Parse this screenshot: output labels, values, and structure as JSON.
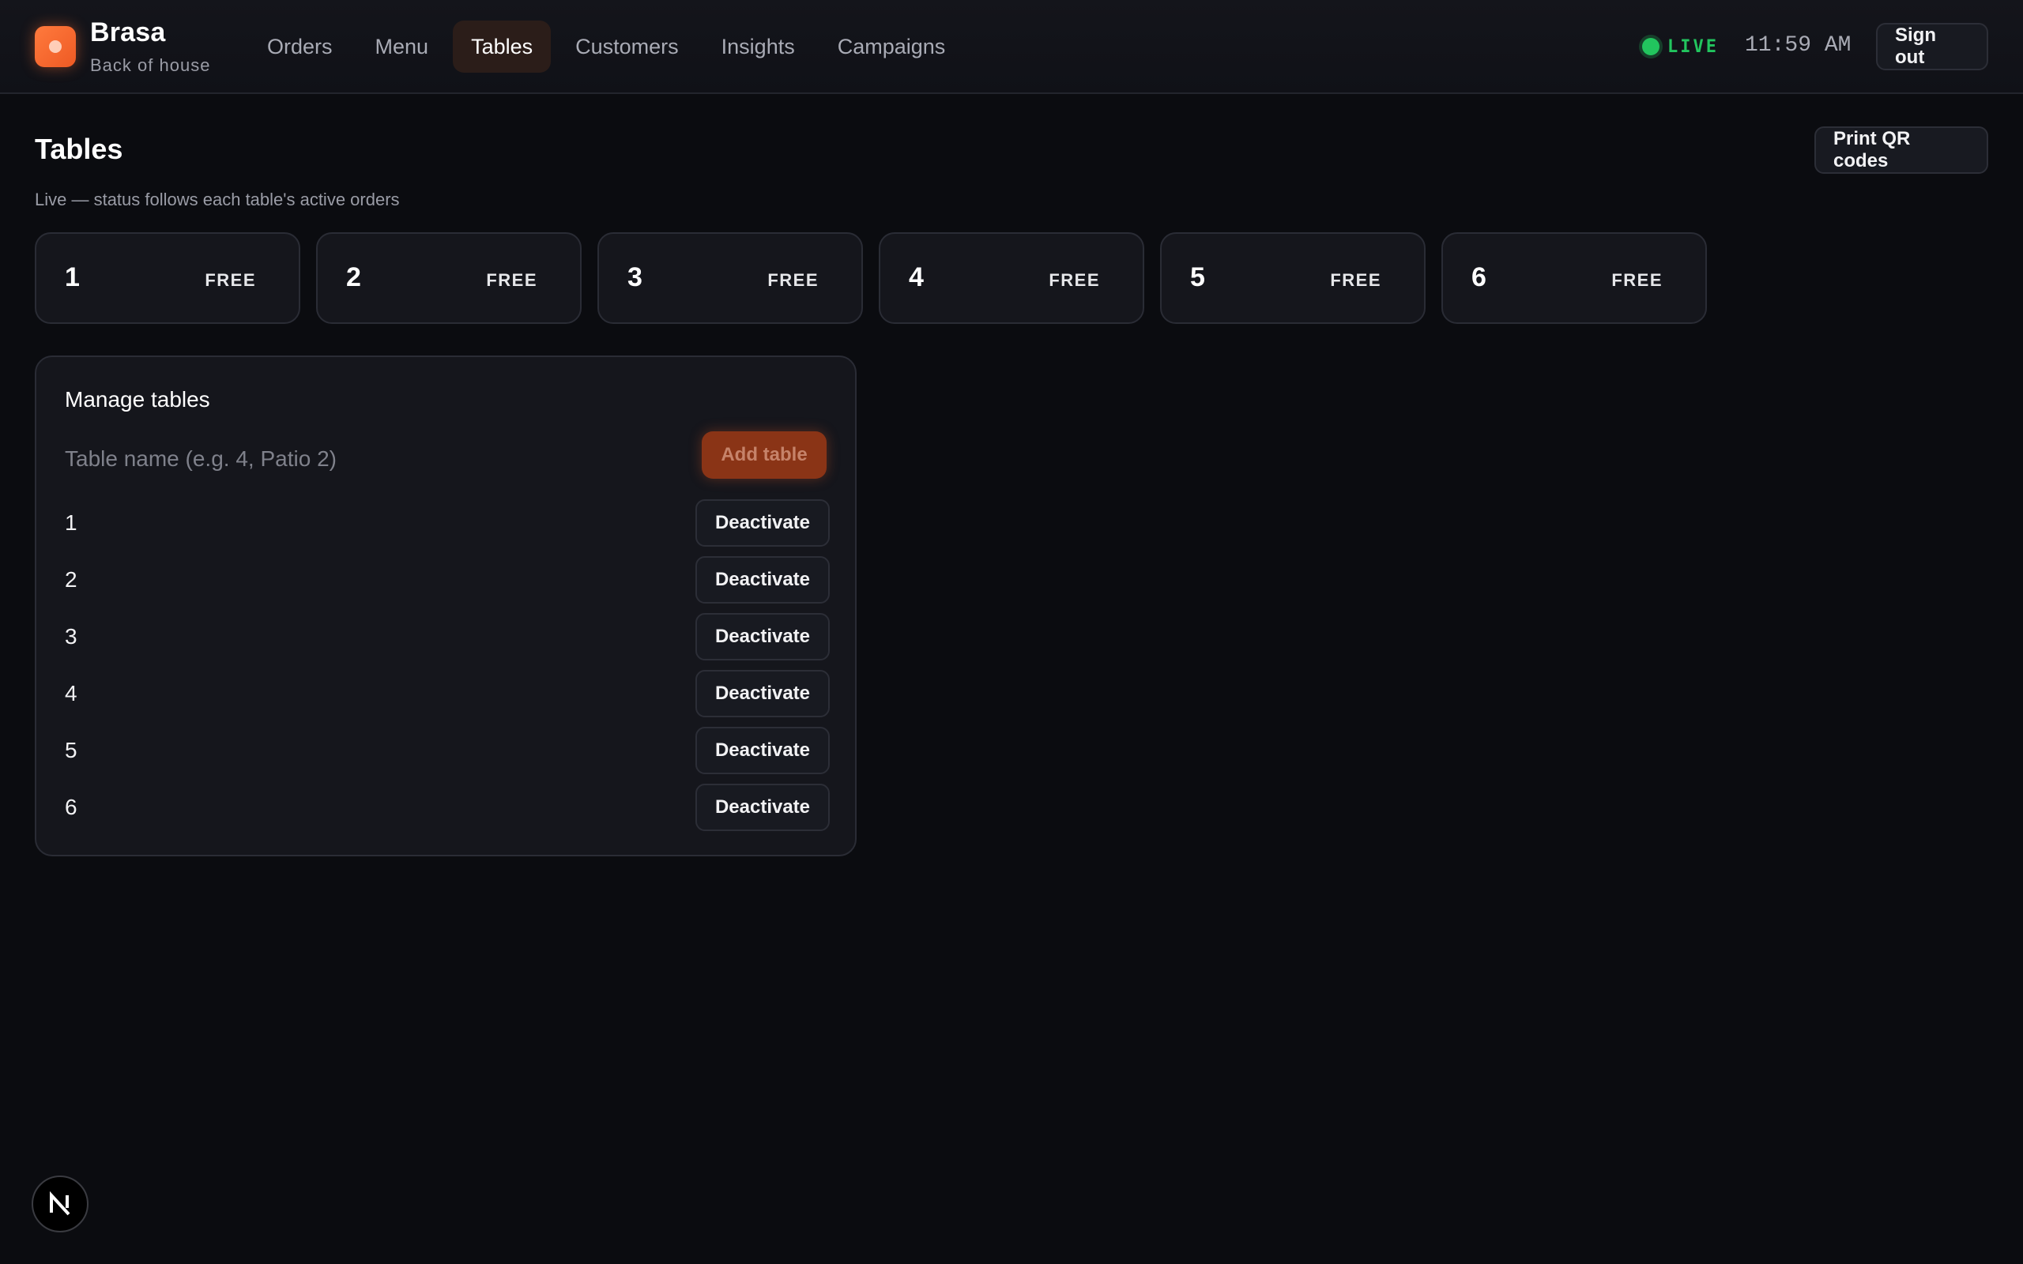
{
  "header": {
    "brand": "Brasa",
    "subtitle": "Back of house",
    "nav": [
      {
        "label": "Orders",
        "active": false
      },
      {
        "label": "Menu",
        "active": false
      },
      {
        "label": "Tables",
        "active": true
      },
      {
        "label": "Customers",
        "active": false
      },
      {
        "label": "Insights",
        "active": false
      },
      {
        "label": "Campaigns",
        "active": false
      }
    ],
    "live_label": "LIVE",
    "time": "11:59 AM",
    "sign_out": "Sign out"
  },
  "page": {
    "title": "Tables",
    "subtitle": "Live — status follows each table's active orders",
    "print_qr": "Print QR codes"
  },
  "tables": [
    {
      "name": "1",
      "status": "FREE"
    },
    {
      "name": "2",
      "status": "FREE"
    },
    {
      "name": "3",
      "status": "FREE"
    },
    {
      "name": "4",
      "status": "FREE"
    },
    {
      "name": "5",
      "status": "FREE"
    },
    {
      "name": "6",
      "status": "FREE"
    }
  ],
  "manage": {
    "title": "Manage tables",
    "input_placeholder": "Table name (e.g. 4, Patio 2)",
    "input_value": "",
    "add_label": "Add table",
    "rows": [
      {
        "name": "1",
        "action": "Deactivate"
      },
      {
        "name": "2",
        "action": "Deactivate"
      },
      {
        "name": "3",
        "action": "Deactivate"
      },
      {
        "name": "4",
        "action": "Deactivate"
      },
      {
        "name": "5",
        "action": "Deactivate"
      },
      {
        "name": "6",
        "action": "Deactivate"
      }
    ]
  },
  "dev_badge": {
    "letter": "N",
    "icon": "nextjs-icon"
  },
  "colors": {
    "accent": "#ff6a2b",
    "live": "#22c55e",
    "background": "#0b0c10",
    "card": "#15161c"
  }
}
